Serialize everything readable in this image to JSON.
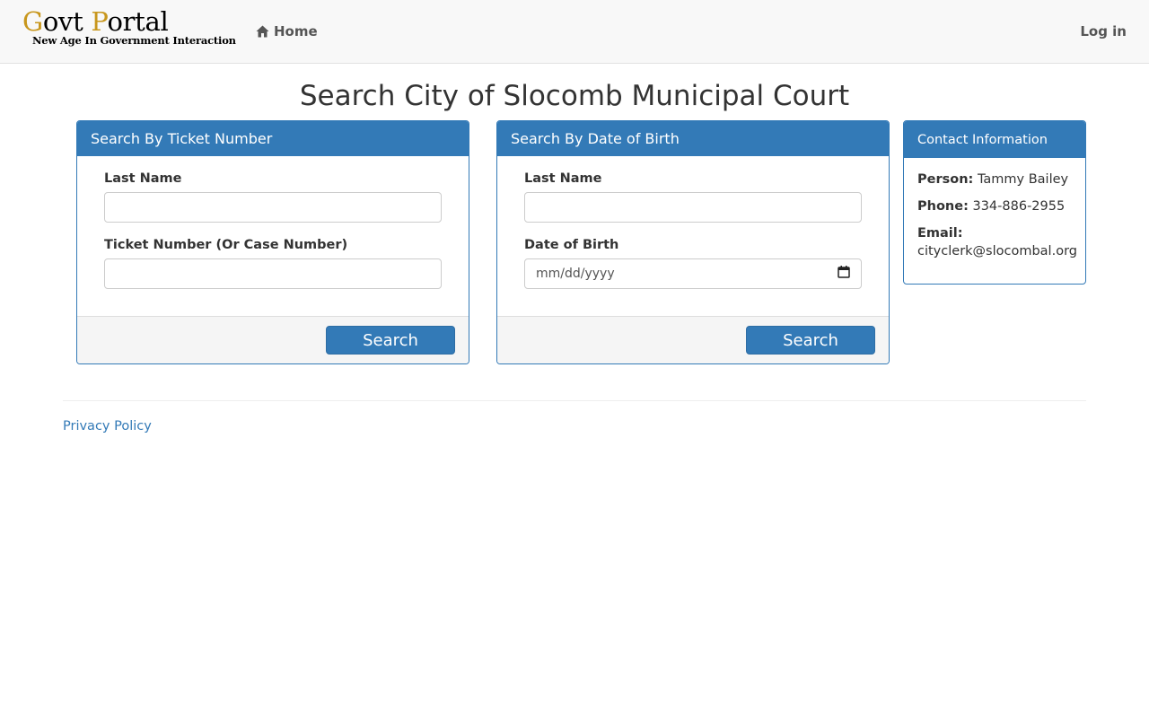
{
  "navbar": {
    "brand_title_cap1": "G",
    "brand_title_part1": "ovt ",
    "brand_title_cap2": "P",
    "brand_title_part2": "ortal",
    "brand_subtitle": "New Age In Government Interaction",
    "home_label": "Home",
    "home_icon": "home-icon",
    "login_label": "Log in"
  },
  "page": {
    "title": "Search City of Slocomb Municipal Court"
  },
  "ticket_search": {
    "heading": "Search By Ticket Number",
    "last_name_label": "Last Name",
    "last_name_value": "",
    "ticket_label": "Ticket Number (Or Case Number)",
    "ticket_value": "",
    "search_label": "Search"
  },
  "dob_search": {
    "heading": "Search By Date of Birth",
    "last_name_label": "Last Name",
    "last_name_value": "",
    "dob_label": "Date of Birth",
    "dob_placeholder": "mm/dd/yyyy",
    "calendar_icon": "calendar-icon",
    "search_label": "Search"
  },
  "contact": {
    "heading": "Contact Information",
    "person_label": "Person:",
    "person_value": "Tammy Bailey",
    "phone_label": "Phone:",
    "phone_value": "334-886-2955",
    "email_label": "Email:",
    "email_value": "cityclerk@slocombal.org"
  },
  "footer": {
    "privacy_label": "Privacy Policy"
  },
  "colors": {
    "primary": "#337ab7",
    "brand_gold": "#c8971d",
    "navbar_bg": "#f8f8f8",
    "footer_panel_bg": "#f5f5f5"
  }
}
